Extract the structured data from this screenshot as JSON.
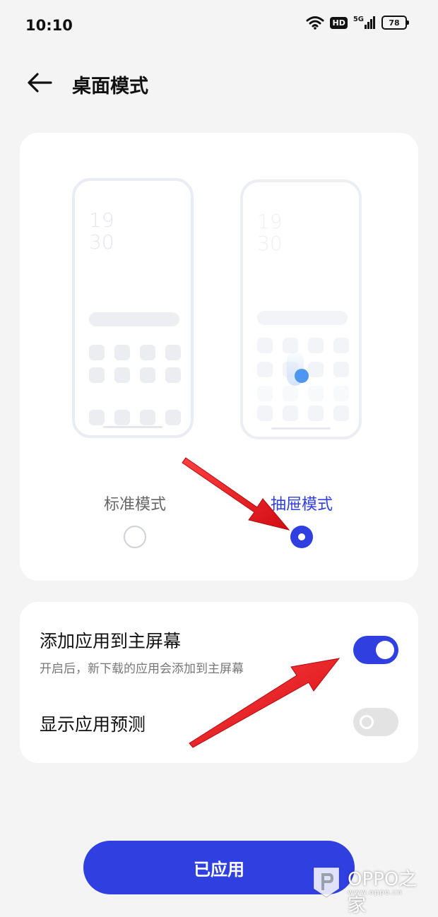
{
  "status_bar": {
    "time": "10:10",
    "hd_label": "HD",
    "signal_label": "5G",
    "battery_level": "78",
    "icons": [
      "wifi-icon",
      "hd-icon",
      "signal-5g-icon",
      "battery-icon"
    ]
  },
  "header": {
    "title": "桌面模式",
    "back_icon": "arrow-left-icon"
  },
  "mode_selector": {
    "preview_clock": {
      "hour": "19",
      "minute": "30"
    },
    "options": [
      {
        "label": "标准模式",
        "selected": false
      },
      {
        "label": "抽屉模式",
        "selected": true
      }
    ]
  },
  "settings": {
    "add_to_home": {
      "title": "添加应用到主屏幕",
      "description": "开启后，新下载的应用会添加到主屏幕",
      "enabled": true
    },
    "show_prediction": {
      "title": "显示应用预测",
      "enabled": false
    }
  },
  "apply_button": {
    "label": "已应用"
  },
  "watermark": {
    "brand": "OPPO之家",
    "url": "www.oppo.cn"
  },
  "colors": {
    "accent": "#2f3fe0",
    "selected_label": "#2f3fe0",
    "unselected_label": "#666666",
    "drawer_dot": "#2f86ee",
    "annotation_arrow": "#e8141b",
    "background": "#f4f4f4",
    "card": "#ffffff"
  }
}
